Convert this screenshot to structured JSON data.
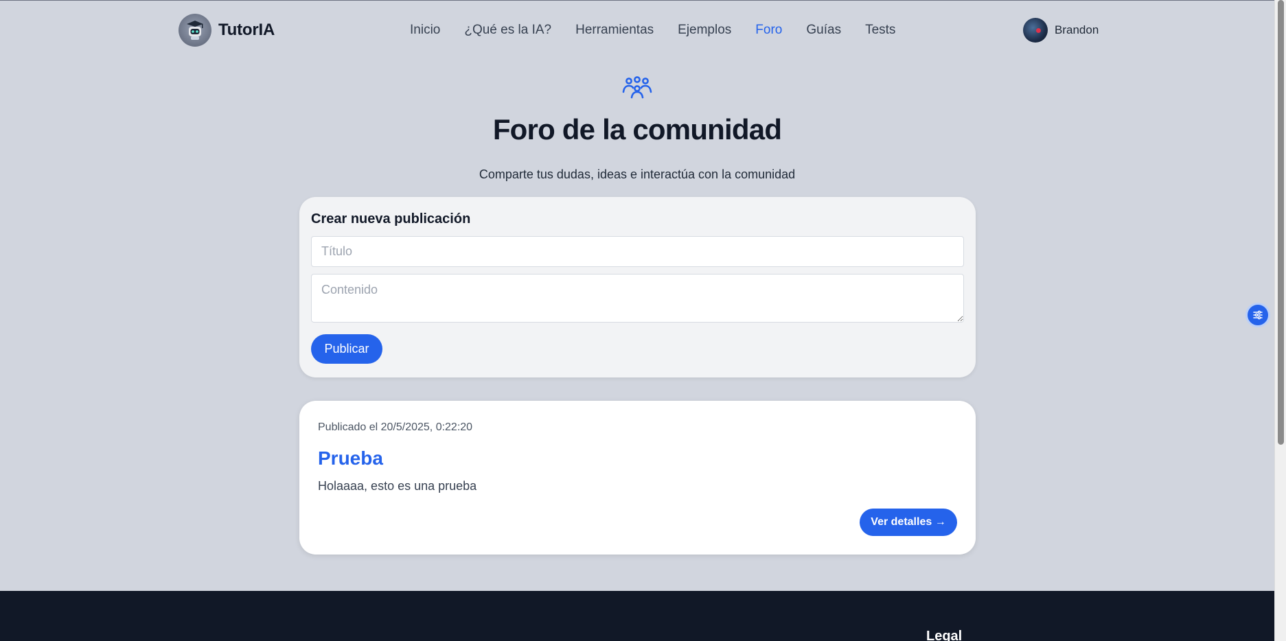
{
  "app": {
    "name": "TutorIA"
  },
  "nav": {
    "items": [
      {
        "label": "Inicio",
        "active": false
      },
      {
        "label": "¿Qué es la IA?",
        "active": false
      },
      {
        "label": "Herramientas",
        "active": false
      },
      {
        "label": "Ejemplos",
        "active": false
      },
      {
        "label": "Foro",
        "active": true
      },
      {
        "label": "Guías",
        "active": false
      },
      {
        "label": "Tests",
        "active": false
      }
    ]
  },
  "user": {
    "name": "Brandon"
  },
  "hero": {
    "icon": "users-group-icon",
    "title": "Foro de la comunidad",
    "subtitle": "Comparte tus dudas, ideas e interactúa con la comunidad"
  },
  "create": {
    "heading": "Crear nueva publicación",
    "title_placeholder": "Título",
    "title_value": "",
    "content_placeholder": "Contenido",
    "content_value": "",
    "publish_label": "Publicar"
  },
  "posts": [
    {
      "date": "Publicado el 20/5/2025, 0:22:20",
      "title": "Prueba",
      "body": "Holaaaa, esto es una prueba",
      "details_label": "Ver detalles →"
    }
  ],
  "footer": {
    "legal_heading": "Legal"
  },
  "colors": {
    "accent": "#2563eb",
    "background": "#d1d5de",
    "footer": "#111827"
  },
  "floating_button": {
    "icon": "sliders-icon"
  }
}
